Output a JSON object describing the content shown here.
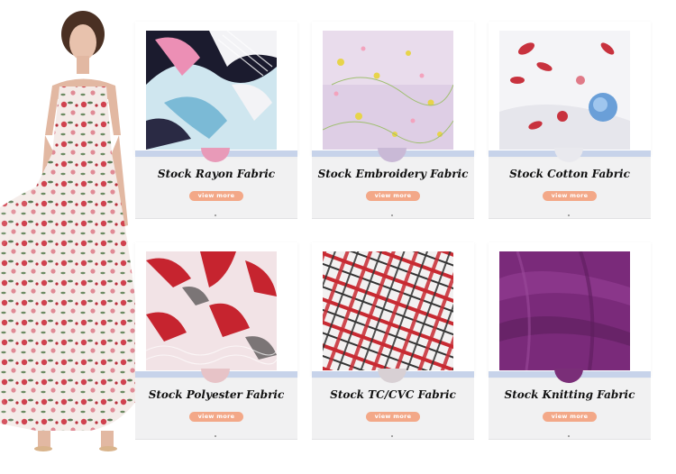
{
  "cards": [
    {
      "title": "Stock Rayon Fabric",
      "button": "view more",
      "notch_color": "#e89ab8"
    },
    {
      "title": "Stock Embroidery Fabric",
      "button": "view more",
      "notch_color": "#c9b9d6"
    },
    {
      "title": "Stock Cotton Fabric",
      "button": "view more",
      "notch_color": "#e9e9ee"
    },
    {
      "title": "Stock Polyester Fabric",
      "button": "view more",
      "notch_color": "#e7c3c7"
    },
    {
      "title": "Stock TC/CVC Fabric",
      "button": "view more",
      "notch_color": "#d8d0d4"
    },
    {
      "title": "Stock Knitting Fabric",
      "button": "view more",
      "notch_color": "#7a2e78"
    }
  ],
  "colors": {
    "button_bg": "#f3a888",
    "strip": "#c7d3ea",
    "card_bg": "#f1f1f2"
  },
  "icons": [
    "rayon-fabric-image",
    "embroidery-fabric-image",
    "cotton-fabric-image",
    "polyester-fabric-image",
    "tc-cvc-fabric-image",
    "knitting-fabric-image",
    "model-image"
  ]
}
